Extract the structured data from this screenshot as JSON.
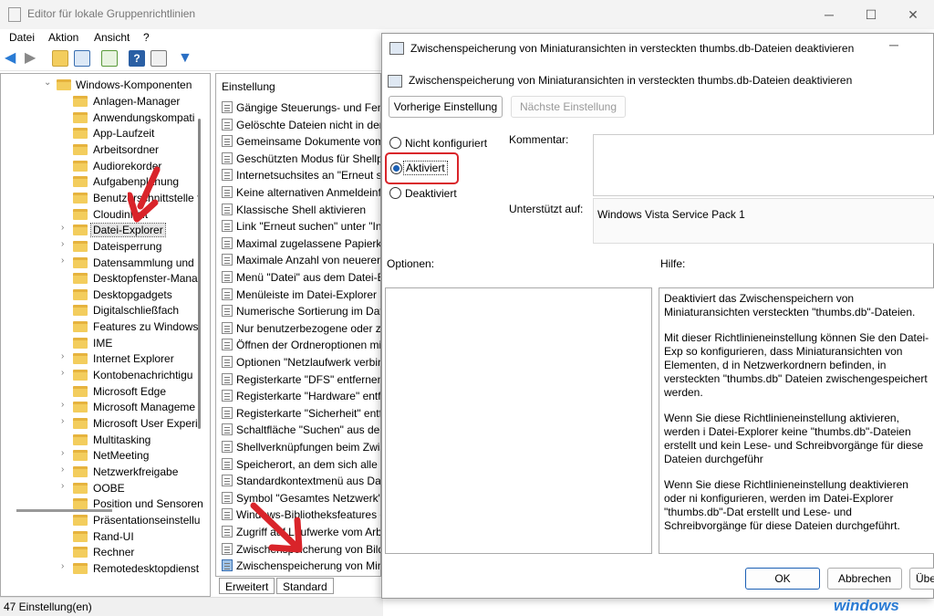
{
  "window": {
    "title": "Editor für lokale Gruppenrichtlinien"
  },
  "menu": [
    "Datei",
    "Aktion",
    "Ansicht",
    "?"
  ],
  "tree": {
    "root": "Windows-Komponenten",
    "items": [
      "Anlagen-Manager",
      "Anwendungskompati",
      "App-Laufzeit",
      "Arbeitsordner",
      "Audiorekorder",
      "Aufgabenplanung",
      "Benutzerschnittstelle f",
      "Cloudinhalt",
      "Datei-Explorer",
      "Dateisperrung",
      "Datensammlung und",
      "Desktopfenster-Mana",
      "Desktopgadgets",
      "Digitalschließfach",
      "Features zu Windows",
      "IME",
      "Internet Explorer",
      "Kontobenachrichtigu",
      "Microsoft Edge",
      "Microsoft Manageme",
      "Microsoft User Experi",
      "Multitasking",
      "NetMeeting",
      "Netzwerkfreigabe",
      "OOBE",
      "Position und Sensoren",
      "Präsentationseinstellu",
      "Rand-UI",
      "Rechner",
      "Remotedesktopdienst"
    ],
    "selected": "Datei-Explorer"
  },
  "list": {
    "header": "Einstellung",
    "items": [
      "Gängige Steuerungs- und Fenst",
      "Gelöschte Dateien nicht in den",
      "Gemeinsame Dokumente vom",
      "Geschützten Modus für Shellpr",
      "Internetsuchsites an \"Erneut su",
      "Keine alternativen Anmeldeinfo",
      "Klassische Shell aktivieren",
      "Link \"Erneut suchen\" unter \"Int",
      "Maximal zugelassene Papierkor",
      "Maximale Anzahl von neueren",
      "Menü \"Datei\" aus dem Datei-Ex",
      "Menüleiste im Datei-Explorer a",
      "Numerische Sortierung im Date",
      "Nur benutzerbezogene oder zu",
      "Öffnen der Ordneroptionen mi",
      "Optionen \"Netzlaufwerk verbin",
      "Registerkarte \"DFS\" entfernen",
      "Registerkarte \"Hardware\" entfe",
      "Registerkarte \"Sicherheit\" entfe",
      "Schaltfläche \"Suchen\" aus dem",
      "Shellverknüpfungen beim Zwis",
      "Speicherort, an dem sich alle St",
      "Standardkontextmenü aus Date",
      "Symbol \"Gesamtes Netzwerk\" r",
      "Windows-Bibliotheksfeatures d",
      "Zugriff auf Laufwerke vom Arb",
      "Zwischenspeicherung von Bilde",
      "Zwischenspeicherung von Mini"
    ]
  },
  "tabs": [
    "Erweitert",
    "Standard"
  ],
  "status": "47 Einstellung(en)",
  "dialog": {
    "title": "Zwischenspeicherung von Miniaturansichten in versteckten thumbs.db-Dateien deaktivieren",
    "heading": "Zwischenspeicherung von Miniaturansichten in versteckten thumbs.db-Dateien deaktivieren",
    "prev_btn": "Vorherige Einstellung",
    "next_btn": "Nächste Einstellung",
    "radio_not_configured": "Nicht konfiguriert",
    "radio_enabled": "Aktiviert",
    "radio_disabled": "Deaktiviert",
    "comment_label": "Kommentar:",
    "supported_label": "Unterstützt auf:",
    "supported_value": "Windows Vista Service Pack 1",
    "options_label": "Optionen:",
    "help_label": "Hilfe:",
    "help_text": [
      "Deaktiviert das Zwischenspeichern von Miniaturansichten versteckten \"thumbs.db\"-Dateien.",
      "Mit dieser Richtlinieneinstellung können Sie den Datei-Exp so konfigurieren, dass Miniaturansichten von Elementen, d in Netzwerkordnern befinden, in versteckten \"thumbs.db\" Dateien zwischengespeichert werden.",
      "Wenn Sie diese Richtlinieneinstellung aktivieren, werden i Datei-Explorer keine \"thumbs.db\"-Dateien erstellt und kein Lese- und Schreibvorgänge für diese Dateien durchgeführ",
      "Wenn Sie diese Richtlinieneinstellung deaktivieren oder ni konfigurieren, werden im Datei-Explorer \"thumbs.db\"-Dat erstellt und Lese- und Schreibvorgänge für diese Dateien durchgeführt."
    ],
    "ok": "OK",
    "cancel": "Abbrechen",
    "apply": "Übe"
  },
  "watermark": "windows",
  "colors": {
    "accent": "#1a5fb4",
    "highlight": "#d9242a"
  }
}
